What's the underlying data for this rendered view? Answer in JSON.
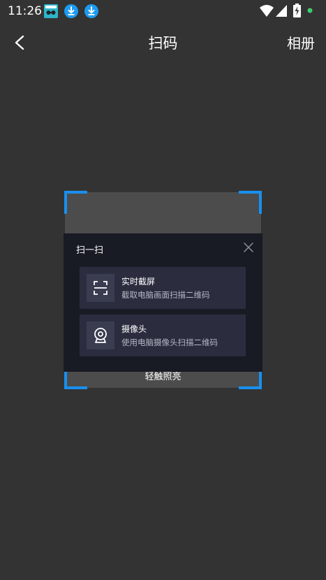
{
  "status_bar": {
    "time": "11:26",
    "icons": [
      "notification-app-icon",
      "download-icon",
      "download-icon",
      "wifi-icon",
      "signal-icon",
      "battery-charging-icon",
      "status-dot-icon"
    ],
    "dot_color": "#3ccc6e"
  },
  "header": {
    "title": "扫码",
    "album_label": "相册",
    "back_icon": "chevron-left-icon"
  },
  "scanner": {
    "flashlight_label": "轻触照亮",
    "corner_color": "#1890f0"
  },
  "popup": {
    "title": "扫一扫",
    "close_icon": "close-icon",
    "options": [
      {
        "icon": "scan-frame-icon",
        "title": "实时截屏",
        "description": "截取电脑画面扫描二维码"
      },
      {
        "icon": "webcam-icon",
        "title": "摄像头",
        "description": "使用电脑摄像头扫描二维码"
      }
    ]
  },
  "colors": {
    "background": "#333333",
    "popup_background": "#181a24",
    "card_background": "#2b2d3f",
    "accent": "#1890f0"
  }
}
